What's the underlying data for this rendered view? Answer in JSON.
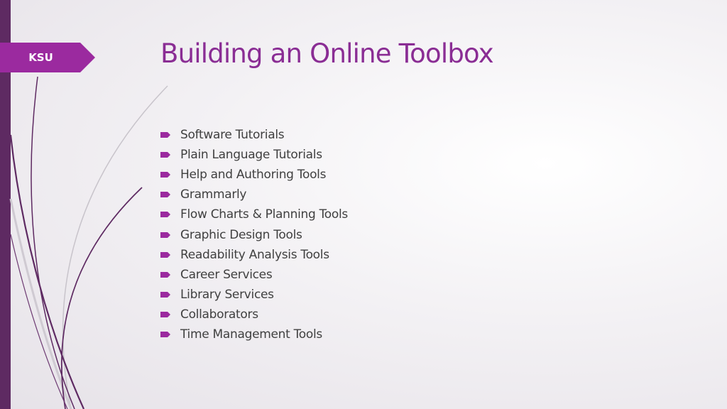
{
  "slide": {
    "tag_label": "KSU",
    "title": "Building an Online Toolbox",
    "bullets": [
      "Software Tutorials",
      "Plain Language Tutorials",
      "Help and Authoring Tools",
      "Grammarly",
      "Flow Charts & Planning Tools",
      "Graphic Design Tools",
      "Readability Analysis Tools",
      "Career Services",
      "Library Services",
      "Collaborators",
      "Time Management Tools"
    ]
  },
  "colors": {
    "accent": "#9b2a9f",
    "sidebar": "#5e2a62",
    "title": "#8a2d94",
    "body_text": "#404040"
  },
  "icons": {
    "bullet": "arrow-tag-bullet-icon"
  }
}
